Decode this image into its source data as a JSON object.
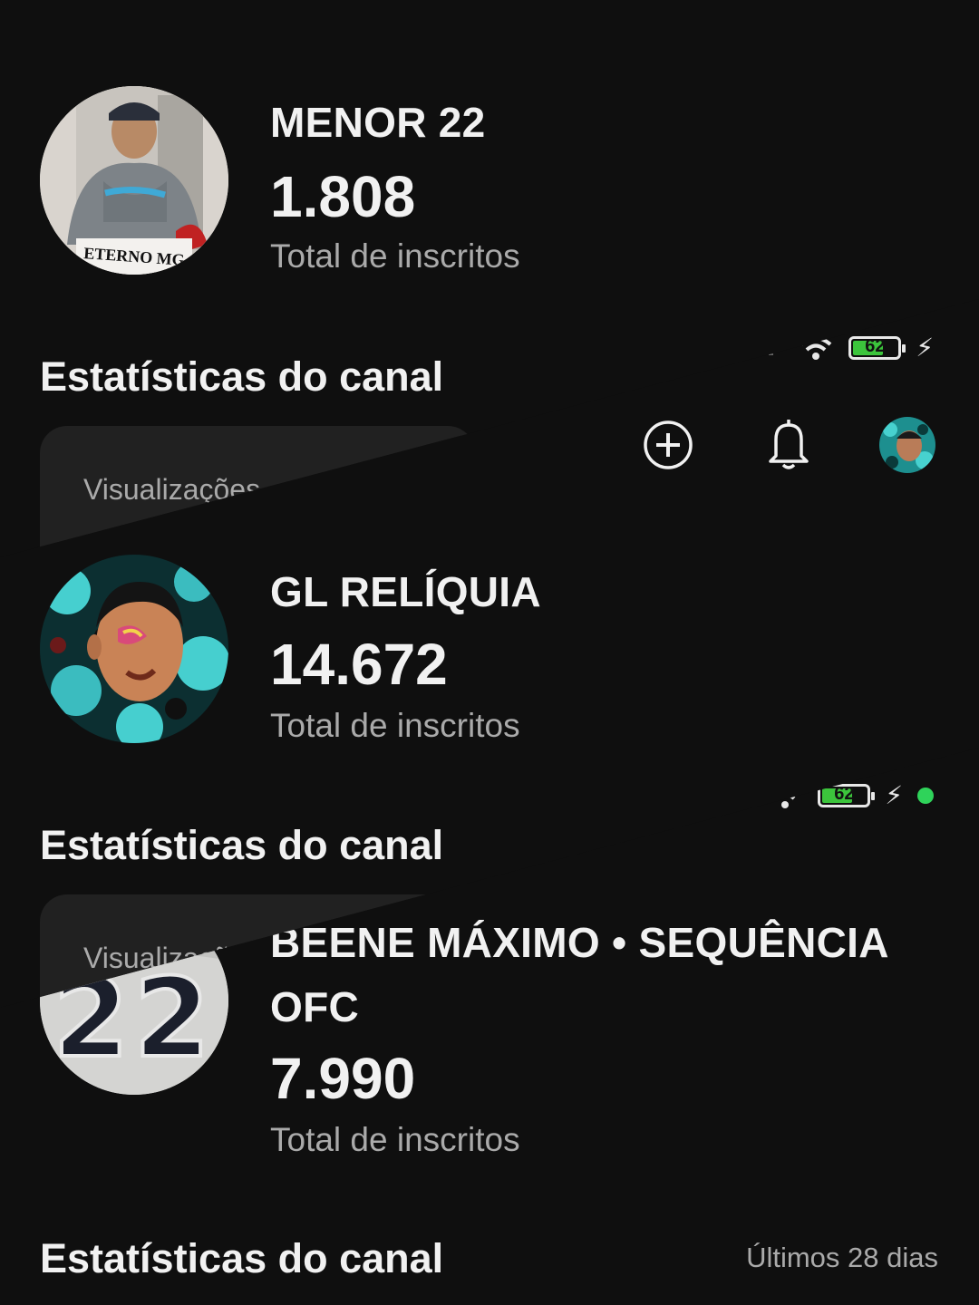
{
  "panels": [
    {
      "channel_name": "MENOR 22",
      "subscribers": "1.808",
      "subscribers_label": "Total de inscritos",
      "avatar_text": "ETERNO MG",
      "section_title": "Estatísticas do canal",
      "card_label": "Visualizações"
    },
    {
      "channel_name": "GL RELÍQUIA",
      "subscribers": "14.672",
      "subscribers_label": "Total de inscritos",
      "section_title": "Estatísticas do canal",
      "card_label": "Visualizações"
    },
    {
      "channel_name_line1": "BEENE MÁXIMO • SEQUÊNCIA",
      "channel_name_line2": "OFC",
      "subscribers": "7.990",
      "subscribers_label": "Total de inscritos",
      "avatar_text": "22",
      "section_title": "Estatísticas do canal",
      "period": "Últimos 28 dias"
    }
  ],
  "status_bar": {
    "battery_level": "62",
    "battery_fill": 0.62
  },
  "header_icons": [
    "create-icon",
    "notifications-icon",
    "account-avatar"
  ],
  "colors": {
    "background": "#0f0f0f",
    "card": "#212121",
    "secondary_text": "#aaaaaa",
    "battery": "#3cc43c",
    "indicator_dot": "#2fd35a"
  }
}
